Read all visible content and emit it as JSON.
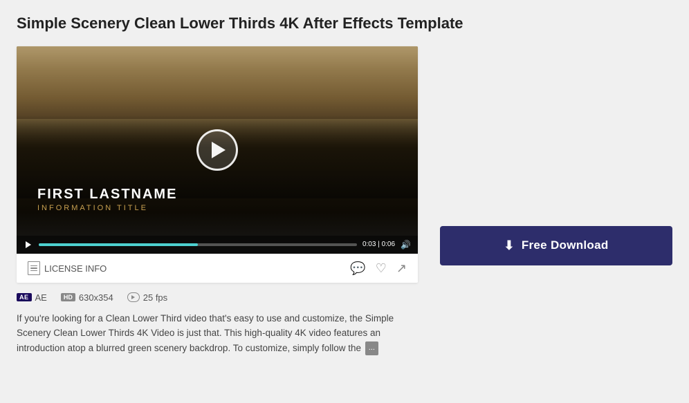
{
  "page": {
    "title": "Simple Scenery Clean Lower Thirds 4K After Effects Template"
  },
  "video": {
    "lower_thirds_name": "FIRST LASTNAME",
    "lower_thirds_title": "INFORMATION TITLE",
    "time_current": "0:03",
    "time_total": "0:06",
    "progress_percent": 50
  },
  "bottom_bar": {
    "license_label": "LICENSE INFO",
    "comment_icon": "💬",
    "like_icon": "♡",
    "share_icon": "↗"
  },
  "meta": {
    "software_label": "AE",
    "resolution_label": "630x354",
    "fps_label": "25 fps"
  },
  "description": {
    "text": "If you're looking for a Clean Lower Third video that's easy to use and customize, the Simple Scenery Clean Lower Thirds 4K Video is just that. This high-quality 4K video features an introduction atop a blurred green scenery backdrop. To customize, simply follow the",
    "more_label": "..."
  },
  "download": {
    "label": "Free Download"
  }
}
